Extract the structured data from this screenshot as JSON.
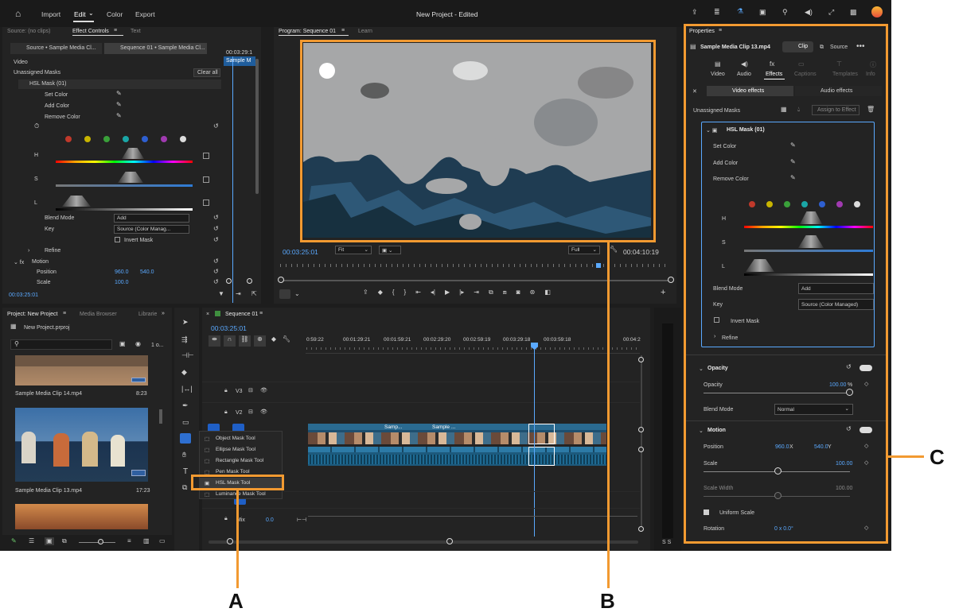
{
  "menu": {
    "import": "Import",
    "edit": "Edit",
    "color": "Color",
    "export": "Export",
    "title": "New Project - Edited"
  },
  "source_panel": {
    "tab_source": "Source: (no clips)",
    "tab_effect": "Effect Controls",
    "tab_text": "Text",
    "src_crumb": "Source • Sample Media Cl...",
    "seq_crumb": "Sequence 01 • Sample Media Cl...",
    "tc_top": "00:03:29:1",
    "clip_name": "Sample M",
    "video": "Video",
    "unassigned": "Unassigned Masks",
    "clear_all": "Clear all",
    "hsl": "HSL Mask (01)",
    "set_color": "Set Color",
    "add_color": "Add Color",
    "remove_color": "Remove Color",
    "h": "H",
    "s": "S",
    "l": "L",
    "blend_mode": "Blend Mode",
    "blend_val": "Add",
    "key": "Key",
    "key_val": "Source (Color Manag...",
    "invert": "Invert Mask",
    "refine": "Refine",
    "motion": "Motion",
    "position": "Position",
    "pos_x": "960.0",
    "pos_y": "540.0",
    "scale": "Scale",
    "scale_val": "100.0",
    "timecode": "00:03:25:01"
  },
  "program": {
    "tab": "Program: Sequence 01",
    "learn": "Learn",
    "timecode": "00:03:25:01",
    "fit": "Fit",
    "full": "Full",
    "duration": "00:04:10:19"
  },
  "properties": {
    "title": "Properties",
    "clip_file": "Sample Media Clip 13.mp4",
    "clip_btn": "Clip",
    "source_btn": "Source",
    "tabs": [
      {
        "label": "Video"
      },
      {
        "label": "Audio"
      },
      {
        "label": "Effects"
      },
      {
        "label": "Captions"
      },
      {
        "label": "Templates"
      },
      {
        "label": "Info"
      }
    ],
    "video_effects": "Video effects",
    "audio_effects": "Audio effects",
    "unassigned": "Unassigned Masks",
    "assign": "Assign to Effect",
    "hsl": "HSL Mask (01)",
    "set_color": "Set Color",
    "add_color": "Add Color",
    "remove_color": "Remove Color",
    "h": "H",
    "s": "S",
    "l": "L",
    "blend_mode": "Blend Mode",
    "blend_val": "Add",
    "key": "Key",
    "key_val": "Source (Color Managed)",
    "invert": "Invert Mask",
    "refine": "Refine",
    "opacity_section": "Opacity",
    "opacity": "Opacity",
    "opacity_val": "100.00",
    "opacity_unit": "%",
    "op_blend": "Blend Mode",
    "op_blend_val": "Normal",
    "motion": "Motion",
    "position": "Position",
    "pos_x": "960.0",
    "pos_x_unit": "X",
    "pos_y": "540.0",
    "pos_y_unit": "Y",
    "scale": "Scale",
    "scale_val": "100.00",
    "scale_width": "Scale Width",
    "scale_width_val": "100.00",
    "uniform": "Uniform Scale",
    "rotation": "Rotation",
    "rotation_val": "0 x 0.0°"
  },
  "project": {
    "tab": "Project: New Project",
    "media_browser": "Media Browser",
    "libraries": "Librarie",
    "file": "New Project.prproj",
    "counter": "1 o...",
    "items": [
      {
        "name": "Sample Media Clip 14.mp4",
        "dur": "8:23"
      },
      {
        "name": "Sample Media Clip 13.mp4",
        "dur": "17:23"
      }
    ]
  },
  "timeline": {
    "tab": "Sequence 01",
    "timecode": "00:03:25:01",
    "ruler": [
      "0:59:22",
      "00:01:29:21",
      "00:01:59:21",
      "00:02:29:20",
      "00:02:59:19",
      "00:03:29:18",
      "00:03:59:18",
      "00:04:2"
    ],
    "tracks": [
      {
        "label": "V3"
      },
      {
        "label": "V2"
      }
    ],
    "mix": "Mix",
    "mix_val": "0.0",
    "clip_labels": [
      "Samp...",
      "Sample ..."
    ]
  },
  "tool_menu": {
    "items": [
      {
        "label": "Object Mask Tool"
      },
      {
        "label": "Ellipse Mask Tool"
      },
      {
        "label": "Rectangle Mask Tool"
      },
      {
        "label": "Pen Mask Tool"
      },
      {
        "label": "HSL Mask Tool"
      },
      {
        "label": "Luminance Mask Tool"
      }
    ]
  },
  "meter": {
    "ss": "S S"
  },
  "callouts": {
    "a": "A",
    "b": "B",
    "c": "C"
  },
  "colors": {
    "accent": "#5aa9ff",
    "callout": "#f29a31",
    "swatches": [
      "#c0392b",
      "#c8b400",
      "#3aa03a",
      "#1aa6a6",
      "#2e5fd0",
      "#a03ab0",
      "#dcdcdc"
    ]
  }
}
